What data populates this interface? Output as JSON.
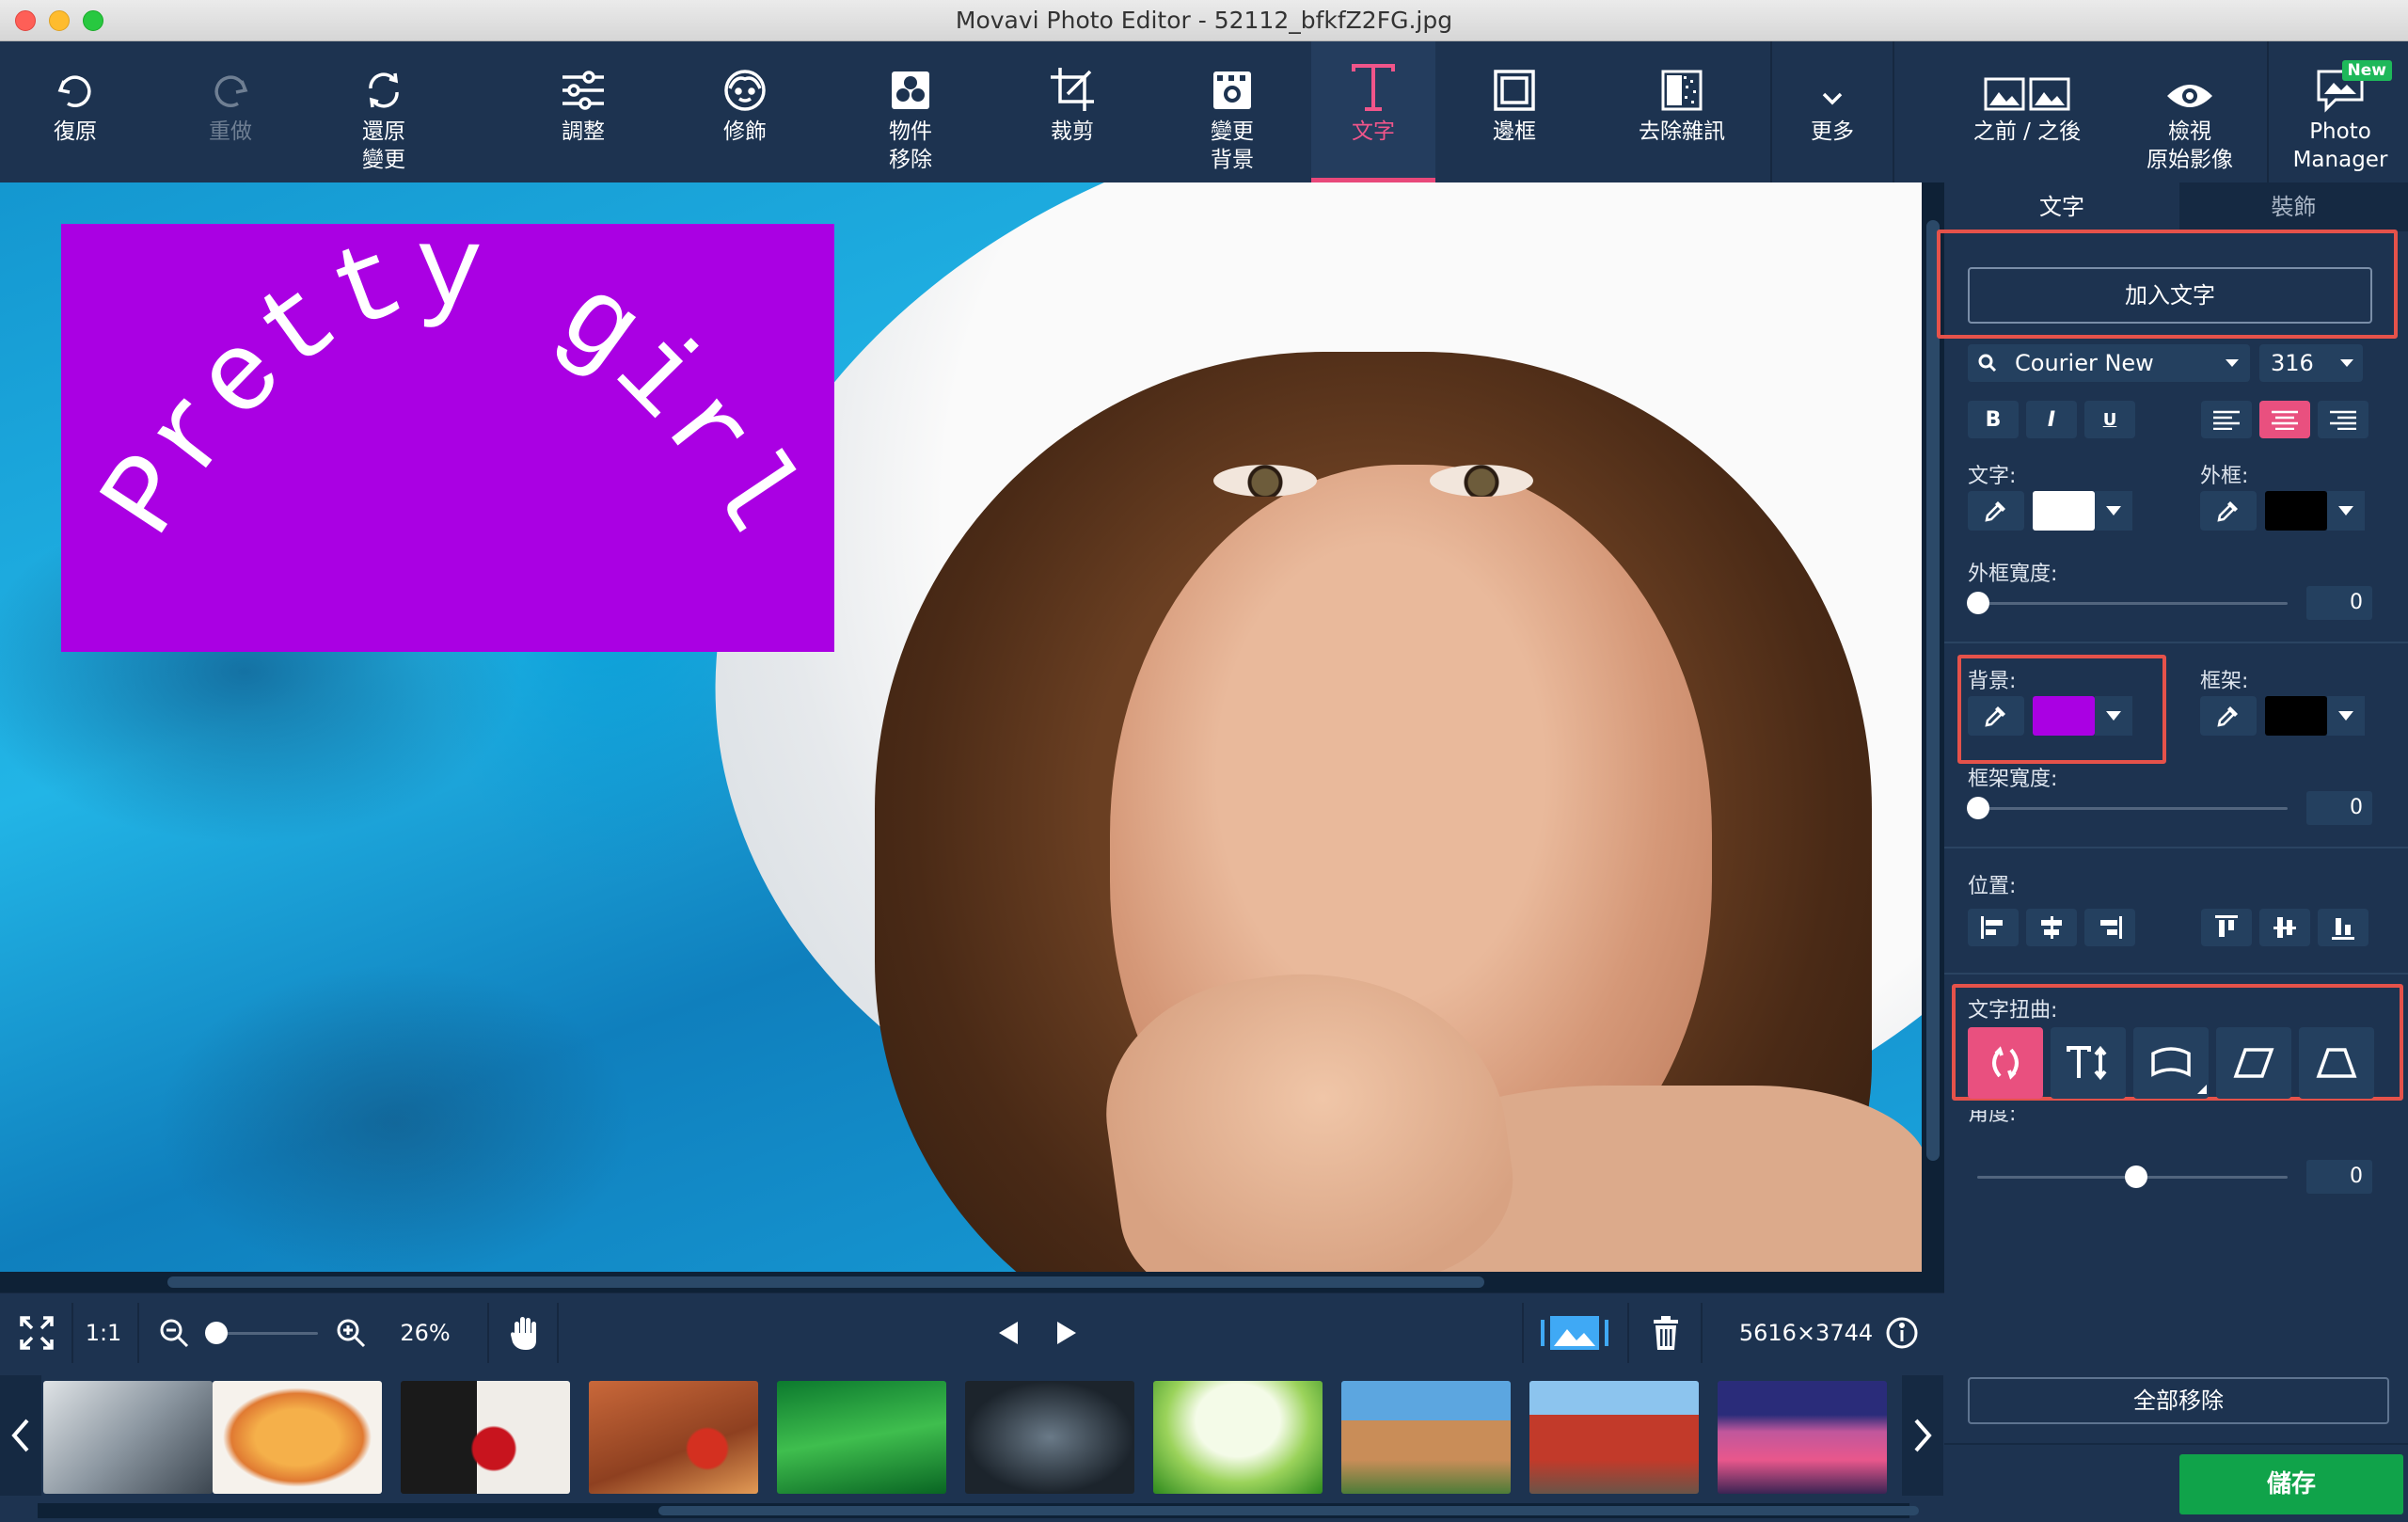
{
  "window": {
    "title": "Movavi Photo Editor - 52112_bfkfZ2FG.jpg"
  },
  "toolbar": {
    "undo": "復原",
    "redo": "重做",
    "revert": [
      "還原",
      "變更"
    ],
    "adjust": "調整",
    "retouch": "修飾",
    "object_removal": [
      "物件",
      "移除"
    ],
    "crop": "裁剪",
    "change_background": [
      "變更",
      "背景"
    ],
    "text": "文字",
    "frames": "邊框",
    "denoise": "去除雜訊",
    "more": "更多",
    "before_after": "之前 / 之後",
    "view_original": [
      "檢視",
      "原始影像"
    ],
    "photo_manager": [
      "Photo",
      "Manager"
    ],
    "new_badge": "New"
  },
  "canvas": {
    "text_object": {
      "text": "Pretty girl",
      "font_color": "#ffffff",
      "background_color": "#aa00e3"
    }
  },
  "bottombar": {
    "fit_label": "1:1",
    "zoom_value": "26%",
    "dimensions": "5616×3744"
  },
  "filmstrip": {
    "thumbnails": [
      "thumb-gym-pushup",
      "thumb-pasta-dish",
      "thumb-red-rose-bouquet",
      "thumb-food-table",
      "thumb-green-droplets",
      "thumb-dumbbell-workout",
      "thumb-green-leaves",
      "thumb-rock-landscape",
      "thumb-chinese-tower",
      "thumb-purple-flower-field"
    ]
  },
  "panel": {
    "tabs": {
      "text": "文字",
      "decoration": "裝飾"
    },
    "add_text_button": "加入文字",
    "font": {
      "name": "Courier New",
      "size": "316"
    },
    "style_buttons": {
      "bold": "B",
      "italic": "I",
      "underline": "U"
    },
    "labels": {
      "text_color": "文字:",
      "outline": "外框:",
      "outline_width": "外框寬度:",
      "background": "背景:",
      "frame": "框架:",
      "frame_width": "框架寬度:",
      "position": "位置:",
      "text_warp": "文字扭曲:",
      "angle": "角度:"
    },
    "values": {
      "outline_width": "0",
      "frame_width": "0",
      "angle": "0"
    },
    "colors": {
      "text": "#ffffff",
      "outline": "#000000",
      "background": "#aa00e3",
      "frame": "#000000",
      "accent": "#e9507f",
      "highlight": "#e5524a"
    },
    "remove_all_button": "全部移除",
    "save_button": "儲存"
  }
}
